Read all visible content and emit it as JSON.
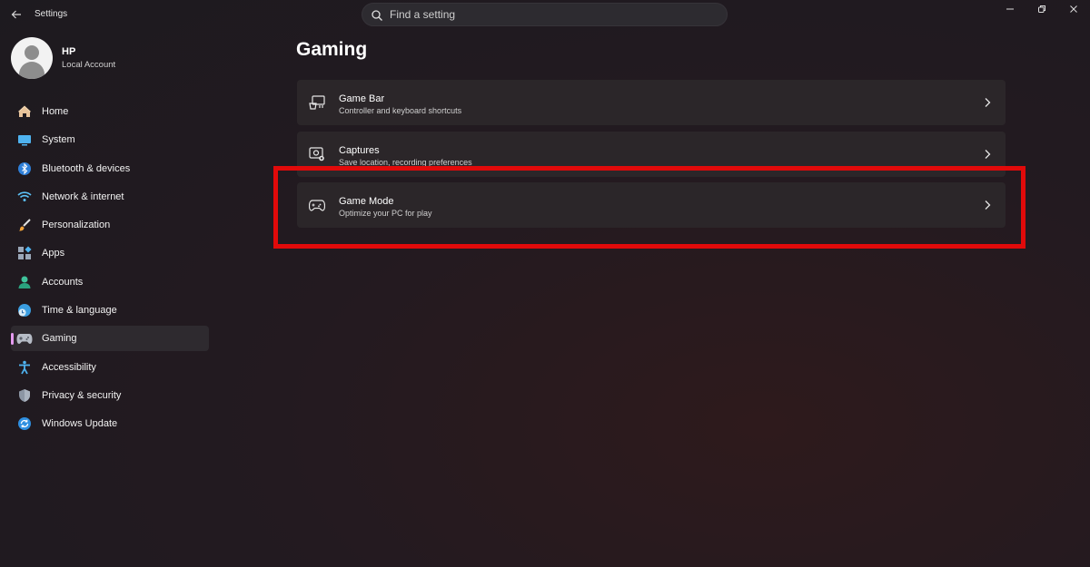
{
  "window": {
    "title": "Settings"
  },
  "search": {
    "placeholder": "Find a setting"
  },
  "profile": {
    "name": "HP",
    "account_type": "Local Account"
  },
  "sidebar": {
    "items": [
      {
        "label": "Home",
        "icon": "home-icon"
      },
      {
        "label": "System",
        "icon": "system-icon"
      },
      {
        "label": "Bluetooth & devices",
        "icon": "bluetooth-icon"
      },
      {
        "label": "Network & internet",
        "icon": "wifi-icon"
      },
      {
        "label": "Personalization",
        "icon": "brush-icon"
      },
      {
        "label": "Apps",
        "icon": "apps-icon"
      },
      {
        "label": "Accounts",
        "icon": "accounts-icon"
      },
      {
        "label": "Time & language",
        "icon": "time-language-icon"
      },
      {
        "label": "Gaming",
        "icon": "gaming-icon",
        "selected": true
      },
      {
        "label": "Accessibility",
        "icon": "accessibility-icon"
      },
      {
        "label": "Privacy & security",
        "icon": "shield-icon"
      },
      {
        "label": "Windows Update",
        "icon": "update-icon"
      }
    ]
  },
  "main": {
    "title": "Gaming",
    "cards": [
      {
        "title": "Game Bar",
        "subtitle": "Controller and keyboard shortcuts",
        "icon": "game-bar-icon"
      },
      {
        "title": "Captures",
        "subtitle": "Save location, recording preferences",
        "icon": "captures-icon"
      },
      {
        "title": "Game Mode",
        "subtitle": "Optimize your PC for play",
        "icon": "game-mode-icon",
        "highlighted": true
      }
    ]
  },
  "colors": {
    "accent": "#e59bf0",
    "highlight_box": "#e10a0a",
    "card_bg": "#2b2629"
  }
}
